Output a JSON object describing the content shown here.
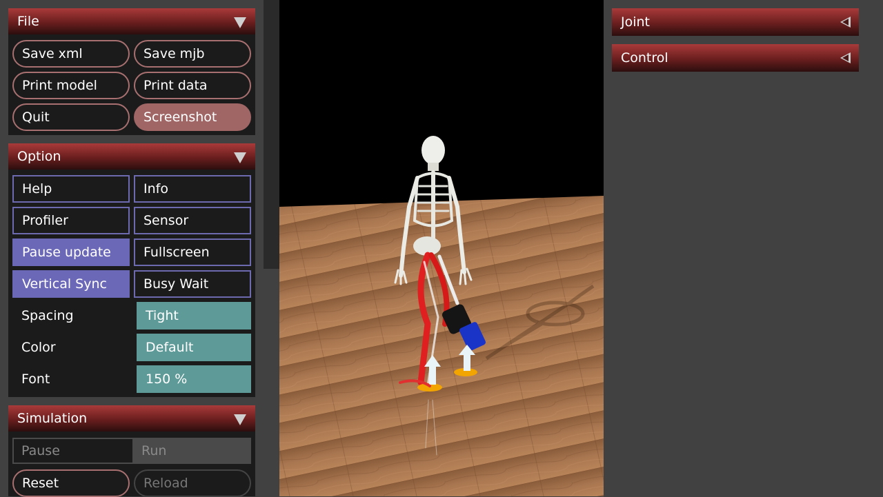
{
  "file": {
    "title": "File",
    "buttons": [
      "Save xml",
      "Save mjb",
      "Print model",
      "Print data",
      "Quit",
      "Screenshot"
    ]
  },
  "option": {
    "title": "Option",
    "toggles": [
      "Help",
      "Info",
      "Profiler",
      "Sensor",
      "Pause update",
      "Fullscreen",
      "Vertical Sync",
      "Busy Wait"
    ],
    "spacing_label": "Spacing",
    "spacing_value": "Tight",
    "color_label": "Color",
    "color_value": "Default",
    "font_label": "Font",
    "font_value": "150 %"
  },
  "simulation": {
    "title": "Simulation",
    "pause_label": "Pause",
    "run_label": "Run",
    "reset_label": "Reset",
    "reload_label": "Reload"
  },
  "right": {
    "joint_title": "Joint",
    "control_title": "Control"
  },
  "colors": {
    "header_red": "#8e2d2d",
    "pill_border": "#a87070",
    "toggle_on": "#6c68b8",
    "select_teal": "#5e9a98",
    "floor_wood": "#a0704a"
  }
}
